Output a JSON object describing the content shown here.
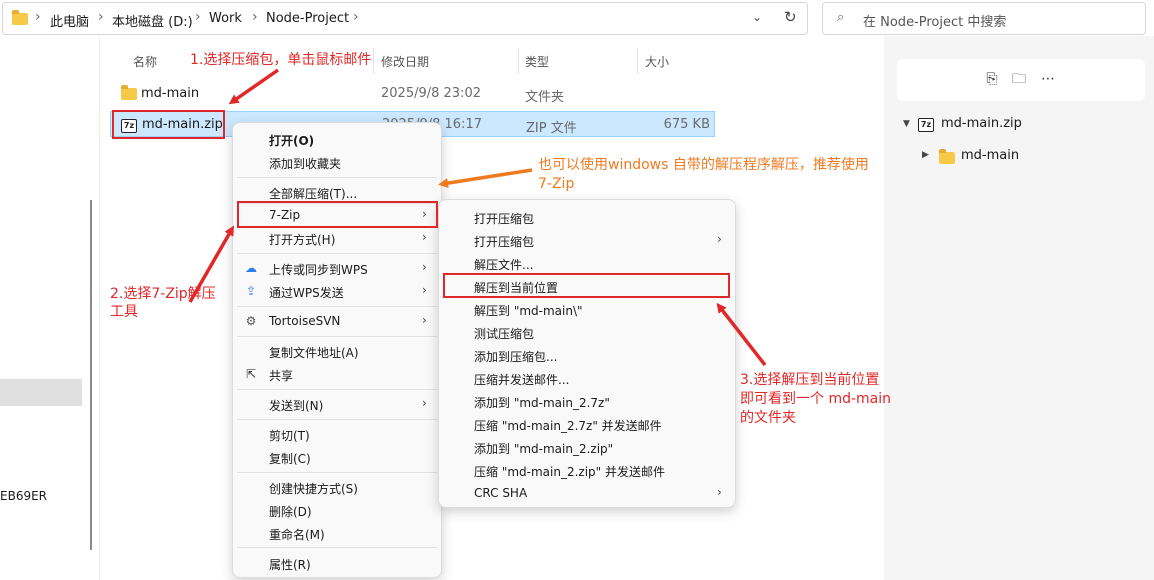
{
  "address": {
    "crumbs": [
      "此电脑",
      "本地磁盘 (D:)",
      "Work",
      "Node-Project"
    ],
    "dropdown_icon": "chevron-down-icon",
    "refresh_icon": "refresh-icon"
  },
  "search": {
    "placeholder": "在 Node-Project 中搜索"
  },
  "columns": {
    "name": "名称",
    "date": "修改日期",
    "type": "类型",
    "size": "大小"
  },
  "files": [
    {
      "name": "md-main",
      "date": "2025/9/8 23:02",
      "type": "文件夹",
      "size": ""
    },
    {
      "name": "md-main.zip",
      "date": "2025/9/8 16:17",
      "type": "ZIP 文件",
      "size": "675 KB"
    }
  ],
  "left_pane": {
    "fragment": "EB69ER"
  },
  "context_menu": {
    "items": [
      "打开(O)",
      "添加到收藏夹",
      "全部解压缩(T)...",
      "7-Zip",
      "打开方式(H)",
      "上传或同步到WPS",
      "通过WPS发送",
      "TortoiseSVN",
      "复制文件地址(A)",
      "共享",
      "发送到(N)",
      "剪切(T)",
      "复制(C)",
      "创建快捷方式(S)",
      "删除(D)",
      "重命名(M)",
      "属性(R)"
    ]
  },
  "submenu": {
    "items": [
      "打开压缩包",
      "打开压缩包",
      "解压文件...",
      "解压到当前位置",
      "解压到 \"md-main\\\"",
      "测试压缩包",
      "添加到压缩包...",
      "压缩并发送邮件...",
      "添加到 \"md-main_2.7z\"",
      "压缩 \"md-main_2.7z\" 并发送邮件",
      "添加到 \"md-main_2.zip\"",
      "压缩 \"md-main_2.zip\" 并发送邮件",
      "CRC SHA"
    ]
  },
  "preview": {
    "root": "md-main.zip",
    "child": "md-main"
  },
  "annotations": {
    "step1": "1.选择压缩包，单击鼠标邮件",
    "step2_line1": "2.选择7-Zip解压",
    "step2_line2": "工具",
    "tip_line1": "也可以使用windows 自带的解压程序解压，推荐使用",
    "tip_line2": "7-Zip",
    "step3_line1": "3.选择解压到当前位置",
    "step3_line2": "即可看到一个 md-main",
    "step3_line3": "的文件夹"
  },
  "colors": {
    "annotation_red": "#e02828",
    "annotation_orange": "#f07a20",
    "selection": "#cce8ff"
  }
}
